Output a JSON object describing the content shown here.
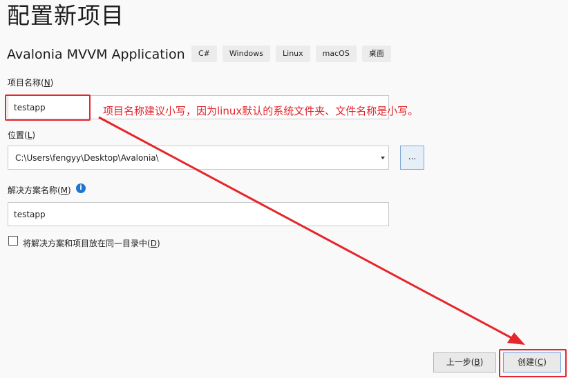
{
  "header": {
    "title": "配置新项目",
    "template_name": "Avalonia MVVM Application",
    "tags": [
      "C#",
      "Windows",
      "Linux",
      "macOS",
      "桌面"
    ]
  },
  "form": {
    "project_name": {
      "label": "项目名称(",
      "access_key": "N",
      "label_end": ")",
      "value": "testapp"
    },
    "location": {
      "label": "位置(",
      "access_key": "L",
      "label_end": ")",
      "value": "C:\\Users\\fengyy\\Desktop\\Avalonia\\",
      "browse_label": "..."
    },
    "solution_name": {
      "label": "解决方案名称(",
      "access_key": "M",
      "label_end": ")",
      "value": "testapp",
      "info_icon": "i"
    },
    "same_dir": {
      "label": "将解决方案和项目放在同一目录中(",
      "access_key": "D",
      "label_end": ")",
      "checked": false
    }
  },
  "footer": {
    "back": {
      "label": "上一步(",
      "access_key": "B",
      "label_end": ")"
    },
    "create": {
      "label": "创建(",
      "access_key": "C",
      "label_end": ")"
    }
  },
  "annotation": {
    "text": "项目名称建议小写，因为linux默认的系统文件夹、文件名称是小写。",
    "color": "#e0242a"
  }
}
